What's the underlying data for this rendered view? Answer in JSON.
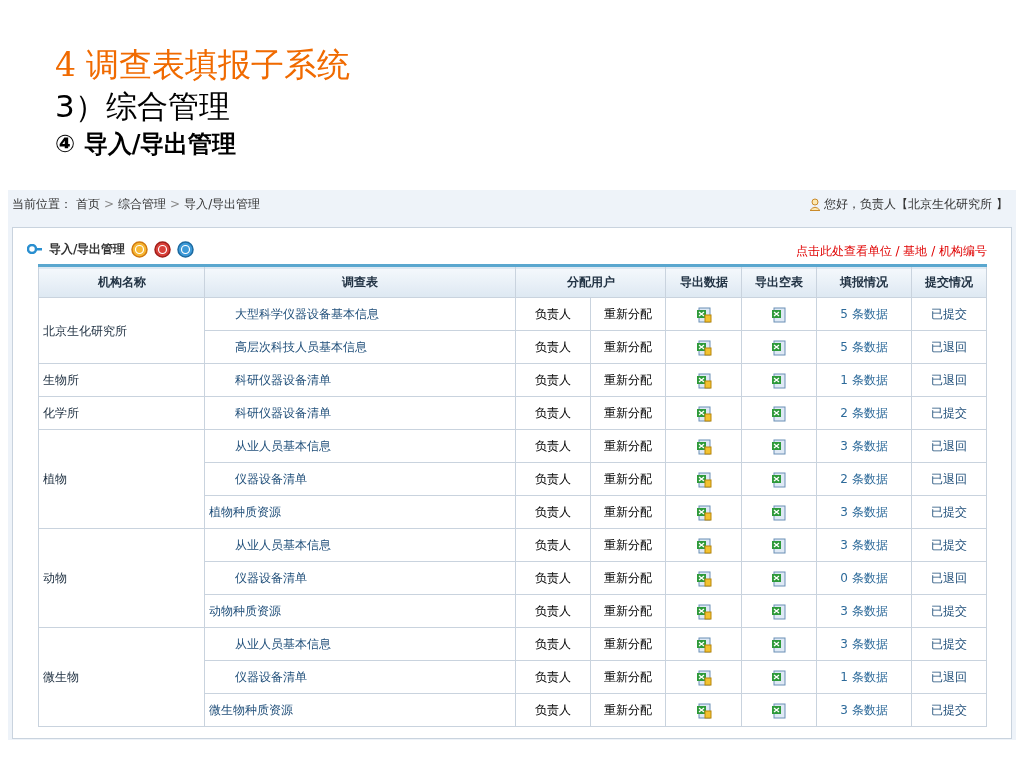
{
  "slide": {
    "title": "4 调查表填报子系统",
    "subtitle": "3）综合管理",
    "section": "④ 导入/导出管理"
  },
  "breadcrumb": {
    "label": "当前位置：",
    "items": [
      "首页",
      "综合管理",
      "导入/导出管理"
    ],
    "separator": ">"
  },
  "greeting": "您好，负责人【北京生化研究所 】",
  "panel": {
    "title": "导入/导出管理",
    "link": "点击此处查看单位 / 基地 / 机构编号"
  },
  "table": {
    "columns": [
      "机构名称",
      "调查表",
      "分配用户",
      "导出数据",
      "导出空表",
      "填报情况",
      "提交情况"
    ],
    "groups": [
      {
        "org": "北京生化研究所",
        "rows": [
          {
            "kind": "form",
            "survey": "大型科学仪器设备基本信息",
            "user": "负责人",
            "action": "重新分配",
            "filled": "5 条数据",
            "status": "已提交"
          },
          {
            "kind": "form",
            "survey": "高层次科技人员基本信息",
            "user": "负责人",
            "action": "重新分配",
            "filled": "5 条数据",
            "status": "已退回"
          }
        ]
      },
      {
        "org": "生物所",
        "rows": [
          {
            "kind": "form",
            "survey": "科研仪器设备清单",
            "user": "负责人",
            "action": "重新分配",
            "filled": "1 条数据",
            "status": "已退回"
          }
        ]
      },
      {
        "org": "化学所",
        "rows": [
          {
            "kind": "form",
            "survey": "科研仪器设备清单",
            "user": "负责人",
            "action": "重新分配",
            "filled": "2 条数据",
            "status": "已提交"
          }
        ]
      },
      {
        "org": "植物",
        "rows": [
          {
            "kind": "form",
            "survey": "从业人员基本信息",
            "user": "负责人",
            "action": "重新分配",
            "filled": "3 条数据",
            "status": "已退回"
          },
          {
            "kind": "form",
            "survey": "仪器设备清单",
            "user": "负责人",
            "action": "重新分配",
            "filled": "2 条数据",
            "status": "已退回"
          },
          {
            "kind": "resource",
            "survey": "植物种质资源",
            "user": "负责人",
            "action": "重新分配",
            "filled": "3 条数据",
            "status": "已提交"
          }
        ]
      },
      {
        "org": "动物",
        "rows": [
          {
            "kind": "form",
            "survey": "从业人员基本信息",
            "user": "负责人",
            "action": "重新分配",
            "filled": "3 条数据",
            "status": "已提交"
          },
          {
            "kind": "form",
            "survey": "仪器设备清单",
            "user": "负责人",
            "action": "重新分配",
            "filled": "0 条数据",
            "status": "已退回"
          },
          {
            "kind": "resource",
            "survey": "动物种质资源",
            "user": "负责人",
            "action": "重新分配",
            "filled": "3 条数据",
            "status": "已提交"
          }
        ]
      },
      {
        "org": "微生物",
        "rows": [
          {
            "kind": "form",
            "survey": "从业人员基本信息",
            "user": "负责人",
            "action": "重新分配",
            "filled": "3 条数据",
            "status": "已提交"
          },
          {
            "kind": "form",
            "survey": "仪器设备清单",
            "user": "负责人",
            "action": "重新分配",
            "filled": "1 条数据",
            "status": "已退回"
          },
          {
            "kind": "resource",
            "survey": "微生物种质资源",
            "user": "负责人",
            "action": "重新分配",
            "filled": "3 条数据",
            "status": "已提交"
          }
        ]
      }
    ]
  }
}
